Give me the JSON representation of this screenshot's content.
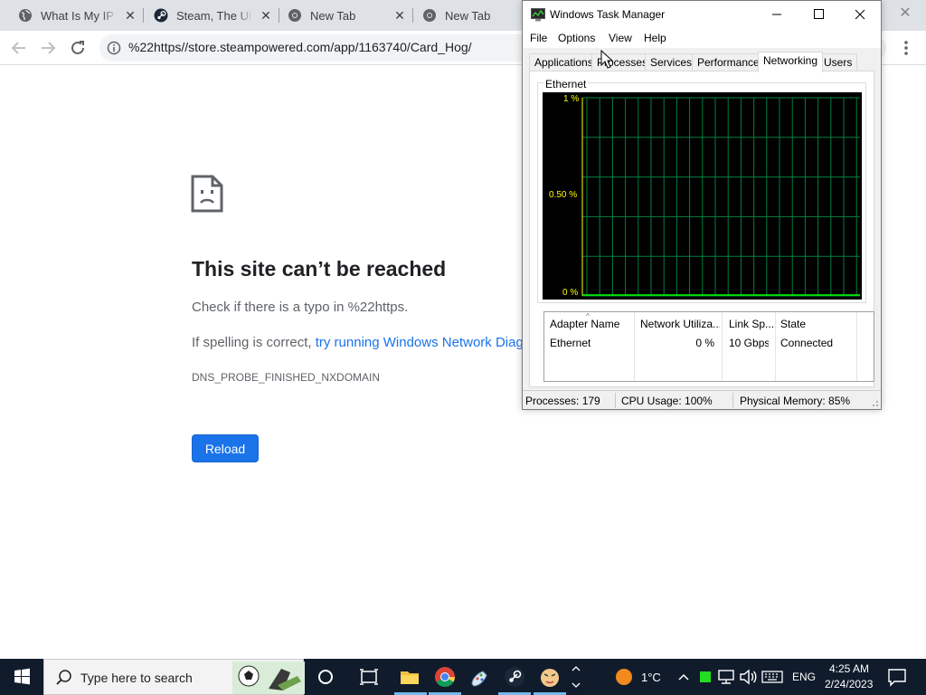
{
  "browser": {
    "tabs": [
      {
        "title": "What Is My IP A",
        "icon": "globe-icon"
      },
      {
        "title": "Steam, The Ultim",
        "icon": "steam-icon"
      },
      {
        "title": "New Tab",
        "icon": "chrome-icon"
      },
      {
        "title": "New Tab",
        "icon": "chrome-icon"
      }
    ],
    "url": "%22https//store.steampowered.com/app/1163740/Card_Hog/"
  },
  "error_page": {
    "title": "This site can’t be reached",
    "line1": "Check if there is a typo in %22https.",
    "line2_prefix": "If spelling is correct, ",
    "line2_link": "try running Windows Network Diagnostics",
    "code": "DNS_PROBE_FINISHED_NXDOMAIN",
    "reload_label": "Reload"
  },
  "task_manager": {
    "title": "Windows Task Manager",
    "menus": [
      "File",
      "Options",
      "View",
      "Help"
    ],
    "tabs": [
      "Applications",
      "Processes",
      "Services",
      "Performance",
      "Networking",
      "Users"
    ],
    "active_tab": "Networking",
    "graph": {
      "group_label": "Ethernet",
      "y_labels": [
        "1 %",
        "0.50 %",
        "0 %"
      ],
      "grid_color": "#008040",
      "line_color": "#00ff00",
      "axis_color": "#ffff00"
    },
    "table": {
      "headers": [
        "Adapter Name",
        "Network Utiliza...",
        "Link Sp...",
        "State"
      ],
      "rows": [
        {
          "adapter": "Ethernet",
          "utilization": "0 %",
          "link_speed": "10 Gbps",
          "state": "Connected"
        }
      ]
    },
    "status": {
      "processes": "Processes: 179",
      "cpu": "CPU Usage: 100%",
      "memory": "Physical Memory: 85%"
    }
  },
  "taskbar": {
    "search_placeholder": "Type here to search",
    "weather": "1°C",
    "language": "ENG",
    "time": "4:25 AM",
    "date": "2/24/2023"
  }
}
